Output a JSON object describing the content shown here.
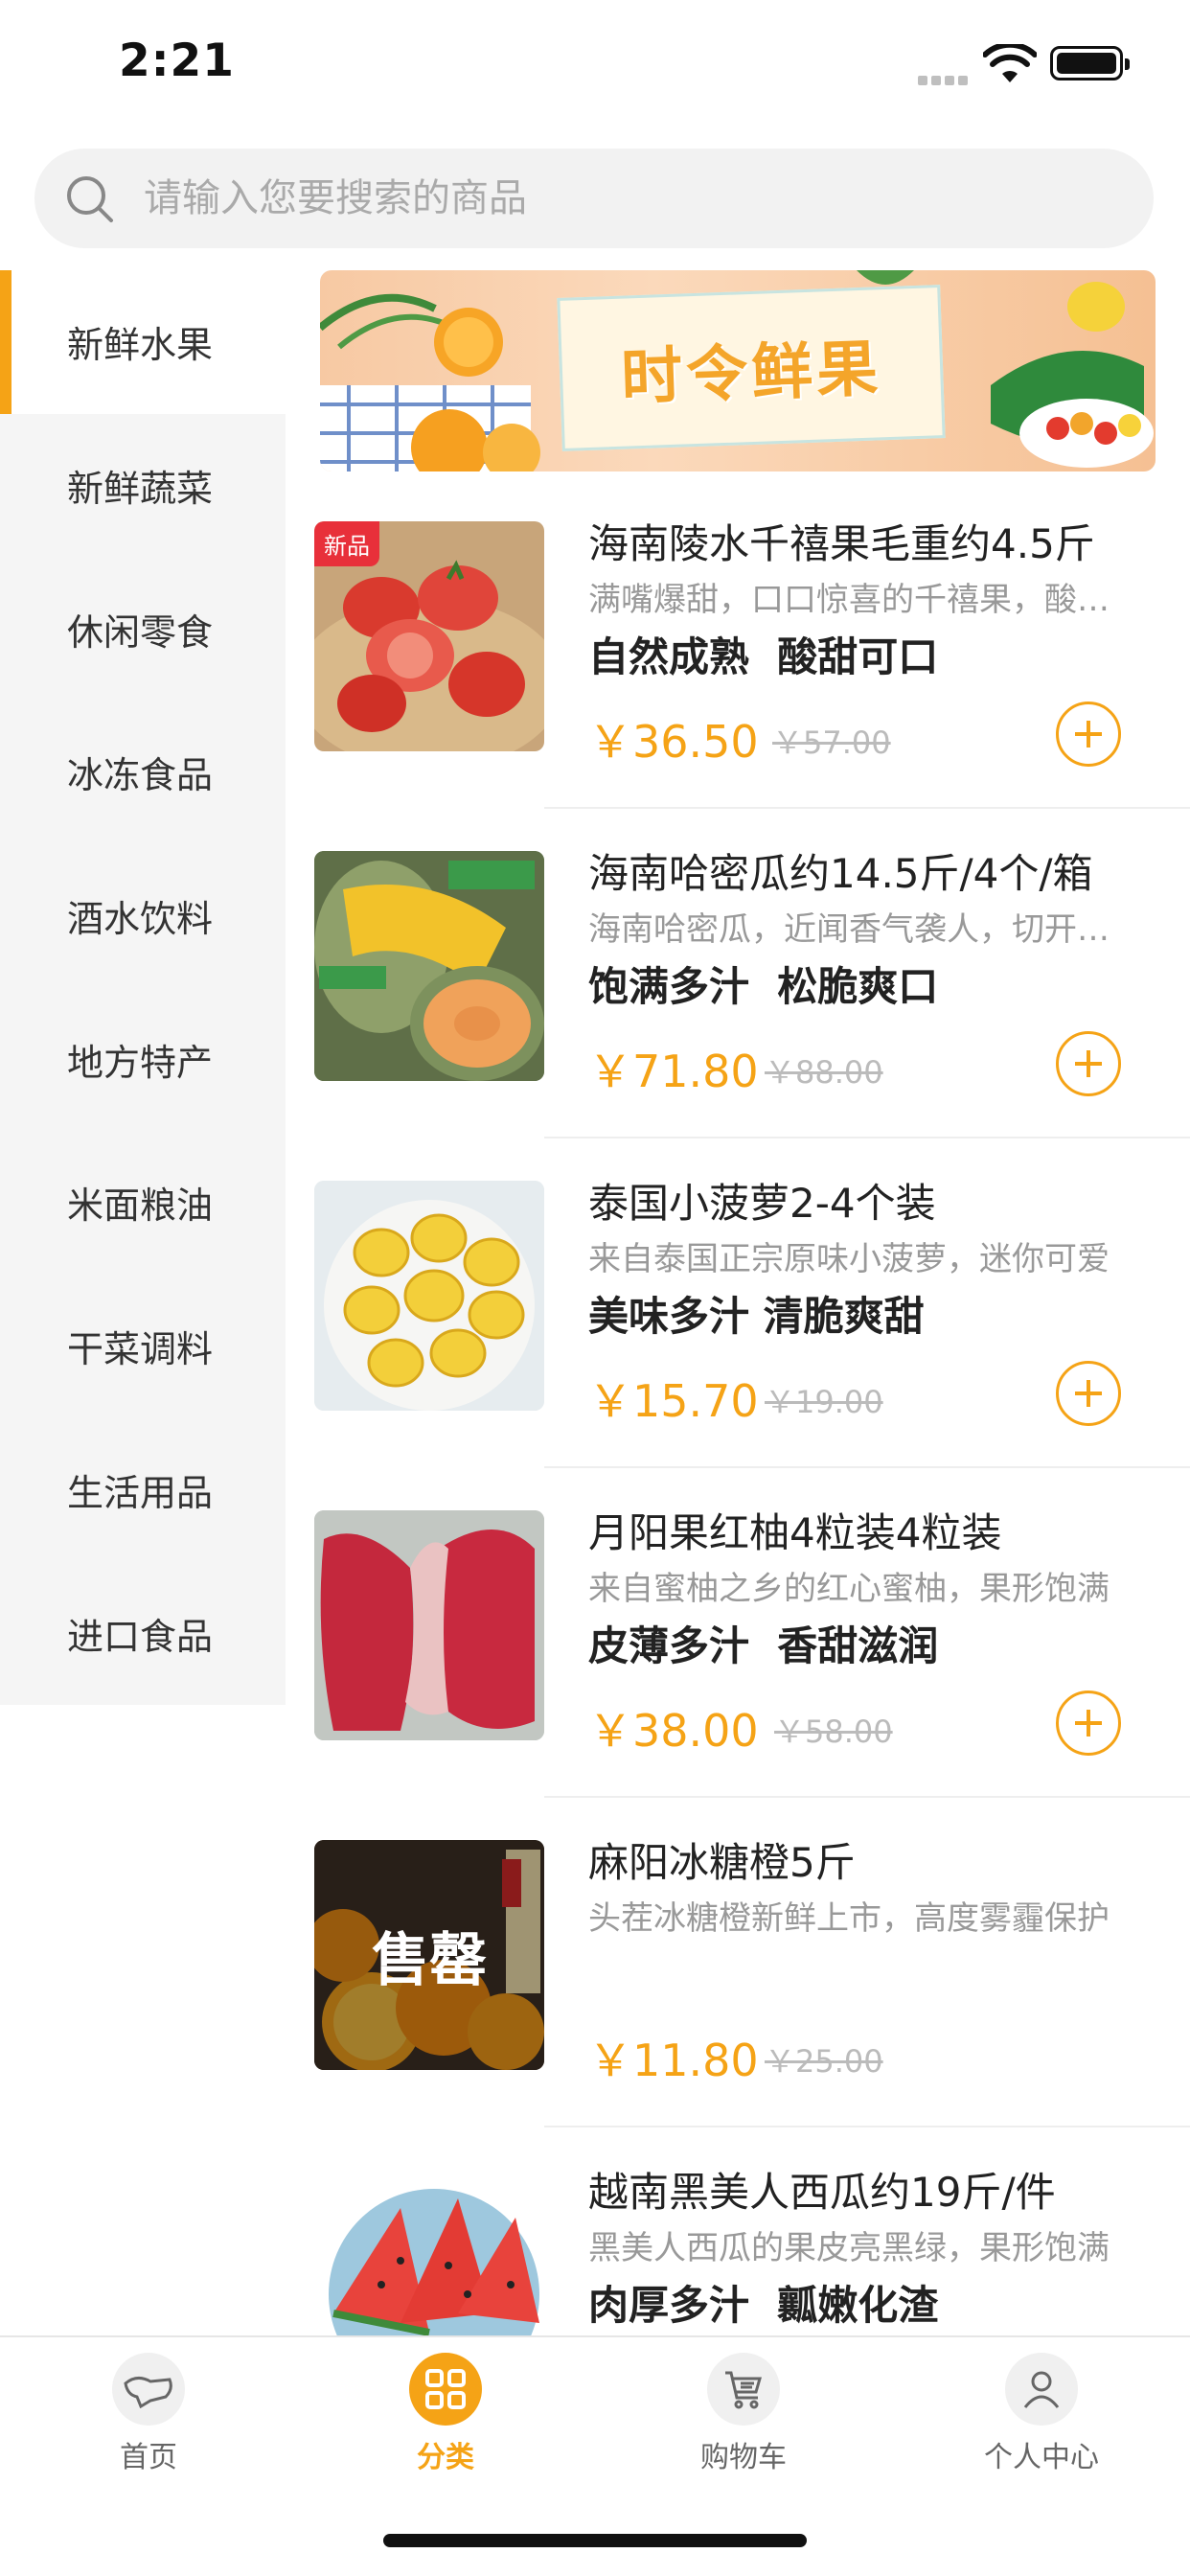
{
  "status_bar": {
    "time": "2:21"
  },
  "search": {
    "placeholder": "请输入您要搜索的商品"
  },
  "categories": [
    {
      "label": "新鲜水果",
      "active": true
    },
    {
      "label": "新鲜蔬菜"
    },
    {
      "label": "休闲零食"
    },
    {
      "label": "冰冻食品"
    },
    {
      "label": "酒水饮料"
    },
    {
      "label": "地方特产"
    },
    {
      "label": "米面粮油"
    },
    {
      "label": "干菜调料"
    },
    {
      "label": "生活用品"
    },
    {
      "label": "进口食品"
    }
  ],
  "banner": {
    "title": "时令鲜果"
  },
  "products": [
    {
      "badge": "新品",
      "title": "海南陵水千禧果毛重约4.5斤",
      "desc": "满嘴爆甜，口口惊喜的千禧果，酸甜可口",
      "slogan": "自然成熟  酸甜可口",
      "price": "￥36.50",
      "original_price": "￥57.00",
      "image": "tomatoes"
    },
    {
      "title": "海南哈密瓜约14.5斤/4个/箱",
      "desc": "海南哈密瓜，近闻香气袭人，切开果肉",
      "slogan": "饱满多汁  松脆爽口",
      "price": "￥71.80",
      "original_price": "￥88.00",
      "image": "cantaloupe"
    },
    {
      "title": "泰国小菠萝2-4个装",
      "desc": "来自泰国正宗原味小菠萝，迷你可爱",
      "slogan": "美味多汁 清脆爽甜",
      "price": "￥15.70",
      "original_price": "￥19.00",
      "image": "pineapple"
    },
    {
      "title": "月阳果红柚4粒装4粒装",
      "desc": "来自蜜柚之乡的红心蜜柚，果形饱满",
      "slogan": "皮薄多汁  香甜滋润",
      "price": "￥38.00",
      "original_price": "￥58.00",
      "image": "pomelo"
    },
    {
      "title": "麻阳冰糖橙5斤",
      "desc": "头茬冰糖橙新鲜上市，高度雾霾保护",
      "slogan": "",
      "price": "￥11.80",
      "original_price": "￥25.00",
      "image": "orange",
      "image_text": "售罄"
    },
    {
      "title": "越南黑美人西瓜约19斤/件",
      "desc": "黑美人西瓜的果皮亮黑绿，果形饱满",
      "slogan": "肉厚多汁  瓤嫩化渣",
      "price": "",
      "original_price": "",
      "image": "watermelon"
    }
  ],
  "tabbar": [
    {
      "label": "首页",
      "icon": "home-icon"
    },
    {
      "label": "分类",
      "icon": "category-icon",
      "active": true
    },
    {
      "label": "购物车",
      "icon": "cart-icon"
    },
    {
      "label": "个人中心",
      "icon": "user-icon"
    }
  ],
  "colors": {
    "accent": "#f5a316",
    "badge": "#e8303a"
  }
}
